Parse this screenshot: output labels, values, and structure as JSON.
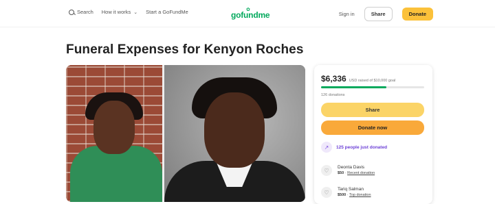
{
  "nav": {
    "search_label": "Search",
    "how_label": "How it works",
    "start_label": "Start a GoFundMe",
    "signin_label": "Sign in",
    "share_label": "Share",
    "donate_label": "Donate"
  },
  "logo": {
    "text": "gofundme",
    "brand_color": "#02a95c"
  },
  "campaign": {
    "title": "Funeral Expenses for Kenyon Roches"
  },
  "card": {
    "amount": "$6,336",
    "goal_text": "USD raised of $10,000 goal",
    "progress_fraction": 0.63,
    "donations_text": "126 donations",
    "share_label": "Share",
    "donate_label": "Donate now",
    "trend_text": "125 people just donated",
    "donors": [
      {
        "name": "Deonta Davis",
        "amount": "$50",
        "tag": "Recent donation"
      },
      {
        "name": "Tariq Salman",
        "amount": "$500",
        "tag": "Top donation"
      }
    ]
  },
  "colors": {
    "accent_yellow": "#fbc13a",
    "share_yellow": "#fbd467",
    "donate_orange": "#f9a93a",
    "trend_purple": "#6b3fd6"
  }
}
